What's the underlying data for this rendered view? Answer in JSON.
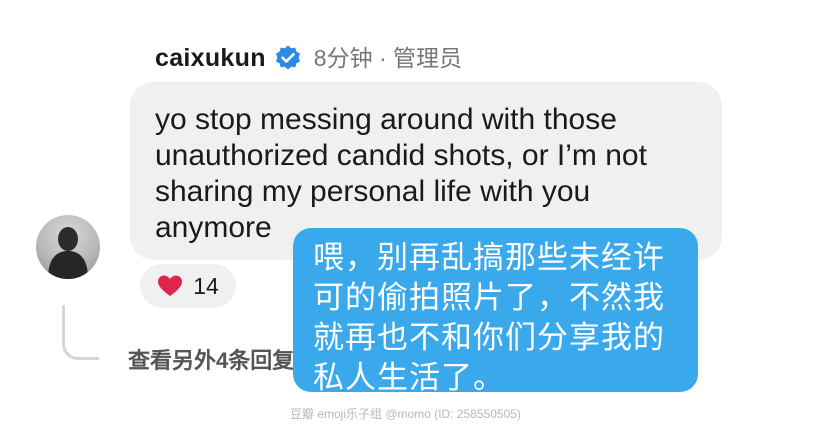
{
  "comment": {
    "username": "caixukun",
    "verified_icon": "verified-badge-icon",
    "meta": "8分钟 · 管理员",
    "text": "yo stop messing around with those unauthorized candid shots, or I’m not sharing my personal life with you anymore"
  },
  "reaction": {
    "icon": "heart-icon",
    "count": "14",
    "color": "#e0244a"
  },
  "replies": {
    "label": "查看另外4条回复"
  },
  "translation": {
    "text": "喂，别再乱搞那些未经许可的偷拍照片了，不然我就再也不和你们分享我的私人生活了。",
    "background": "#3aa9ec"
  },
  "watermark": {
    "text": "豆瓣  emoji乐子组 @momo (ID: 258550505)"
  },
  "colors": {
    "verified_blue": "#2a8ae6",
    "bubble_gray": "#f0f0f0"
  }
}
